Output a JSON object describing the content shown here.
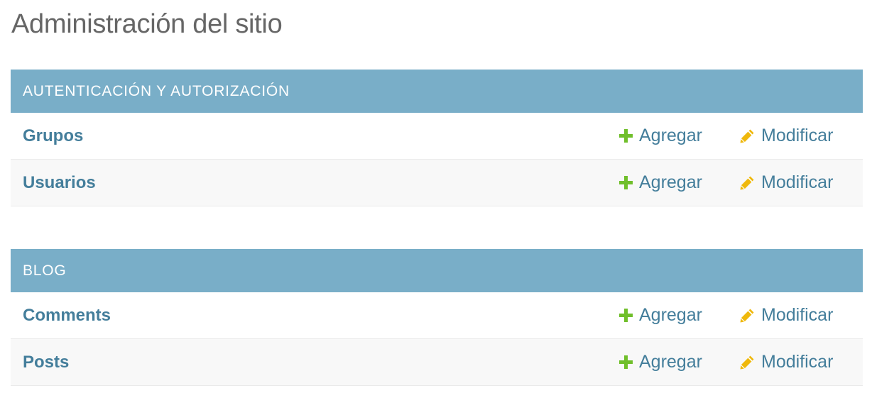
{
  "header": {
    "title": "Administración del sitio"
  },
  "modules": [
    {
      "caption": "AUTENTICACIÓN Y AUTORIZACIÓN",
      "models": [
        {
          "name": "Grupos",
          "add_label": "Agregar",
          "change_label": "Modificar"
        },
        {
          "name": "Usuarios",
          "add_label": "Agregar",
          "change_label": "Modificar"
        }
      ]
    },
    {
      "caption": "BLOG",
      "models": [
        {
          "name": "Comments",
          "add_label": "Agregar",
          "change_label": "Modificar"
        },
        {
          "name": "Posts",
          "add_label": "Agregar",
          "change_label": "Modificar"
        }
      ]
    }
  ],
  "icons": {
    "add": "plus-icon",
    "change": "pencil-icon"
  },
  "colors": {
    "caption_bg": "#79aec8",
    "link": "#447e9b",
    "add_icon": "#70bf2b",
    "change_icon": "#efb80b",
    "row_alt_bg": "#f8f8f8"
  }
}
